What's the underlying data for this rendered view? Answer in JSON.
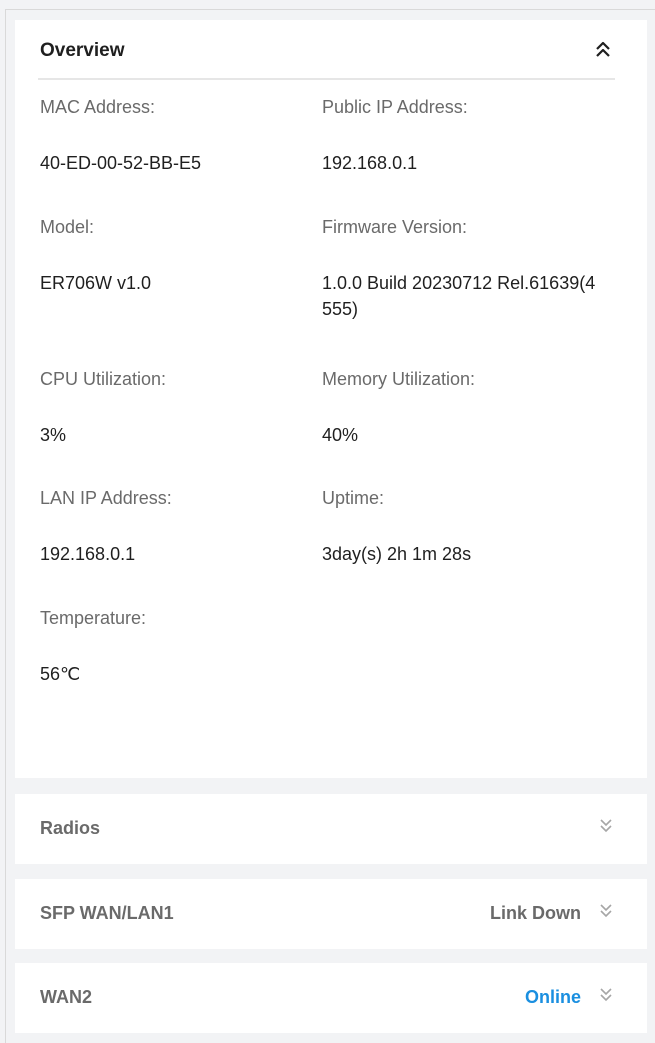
{
  "overview": {
    "title": "Overview",
    "fields": {
      "mac_label": "MAC Address:",
      "mac_value": "40-ED-00-52-BB-E5",
      "public_ip_label": "Public IP Address:",
      "public_ip_value": "192.168.0.1",
      "model_label": "Model:",
      "model_value": "ER706W v1.0",
      "firmware_label": "Firmware Version:",
      "firmware_value": "1.0.0 Build 20230712 Rel.61639(4555)",
      "cpu_label": "CPU Utilization:",
      "cpu_value": "3%",
      "memory_label": "Memory Utilization:",
      "memory_value": "40%",
      "lan_ip_label": "LAN IP Address:",
      "lan_ip_value": "192.168.0.1",
      "uptime_label": "Uptime:",
      "uptime_value": "3day(s) 2h 1m 28s",
      "temperature_label": "Temperature:",
      "temperature_value": "56℃"
    },
    "collapse_icon": "double-chevron-up-icon"
  },
  "sections": {
    "radios": {
      "title": "Radios",
      "status": "",
      "icon": "double-chevron-down-icon"
    },
    "sfp": {
      "title": "SFP WAN/LAN1",
      "status": "Link Down",
      "icon": "double-chevron-down-icon"
    },
    "wan2": {
      "title": "WAN2",
      "status": "Online",
      "icon": "double-chevron-down-icon"
    }
  },
  "colors": {
    "label": "#6a6a6a",
    "value": "#1f1f1f",
    "online": "#1a8fe0",
    "chevron_muted": "#a6a6a6"
  }
}
